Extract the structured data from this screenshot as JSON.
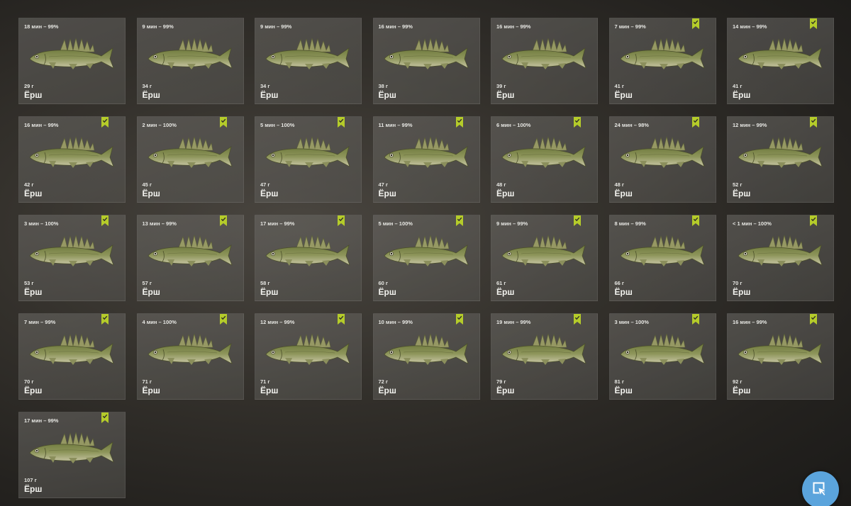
{
  "colors": {
    "accent_flag": "#b5cc2a",
    "button": "#5ba4dc"
  },
  "catches": [
    {
      "time": "18 мин – 99%",
      "weight": "29 г",
      "name": "Ёрш",
      "flag": false
    },
    {
      "time": "9 мин – 99%",
      "weight": "34 г",
      "name": "Ёрш",
      "flag": false
    },
    {
      "time": "9 мин – 99%",
      "weight": "34 г",
      "name": "Ёрш",
      "flag": false
    },
    {
      "time": "16 мин – 99%",
      "weight": "38 г",
      "name": "Ёрш",
      "flag": false
    },
    {
      "time": "16 мин – 99%",
      "weight": "39 г",
      "name": "Ёрш",
      "flag": false
    },
    {
      "time": "7 мин – 99%",
      "weight": "41 г",
      "name": "Ёрш",
      "flag": true
    },
    {
      "time": "14 мин – 99%",
      "weight": "41 г",
      "name": "Ёрш",
      "flag": true
    },
    {
      "time": "16 мин – 99%",
      "weight": "42 г",
      "name": "Ёрш",
      "flag": true
    },
    {
      "time": "2 мин – 100%",
      "weight": "45 г",
      "name": "Ёрш",
      "flag": true
    },
    {
      "time": "5 мин – 100%",
      "weight": "47 г",
      "name": "Ёрш",
      "flag": true
    },
    {
      "time": "11 мин – 99%",
      "weight": "47 г",
      "name": "Ёрш",
      "flag": true
    },
    {
      "time": "6 мин – 100%",
      "weight": "48 г",
      "name": "Ёрш",
      "flag": true
    },
    {
      "time": "24 мин – 98%",
      "weight": "48 г",
      "name": "Ёрш",
      "flag": true
    },
    {
      "time": "12 мин – 99%",
      "weight": "52 г",
      "name": "Ёрш",
      "flag": true
    },
    {
      "time": "3 мин – 100%",
      "weight": "53 г",
      "name": "Ёрш",
      "flag": true
    },
    {
      "time": "13 мин – 99%",
      "weight": "57 г",
      "name": "Ёрш",
      "flag": true
    },
    {
      "time": "17 мин – 99%",
      "weight": "58 г",
      "name": "Ёрш",
      "flag": true
    },
    {
      "time": "5 мин – 100%",
      "weight": "60 г",
      "name": "Ёрш",
      "flag": true
    },
    {
      "time": "9 мин – 99%",
      "weight": "61 г",
      "name": "Ёрш",
      "flag": true
    },
    {
      "time": "8 мин – 99%",
      "weight": "66 г",
      "name": "Ёрш",
      "flag": true
    },
    {
      "time": "< 1 мин – 100%",
      "weight": "70 г",
      "name": "Ёрш",
      "flag": true
    },
    {
      "time": "7 мин – 99%",
      "weight": "70 г",
      "name": "Ёрш",
      "flag": true
    },
    {
      "time": "4 мин – 100%",
      "weight": "71 г",
      "name": "Ёрш",
      "flag": true
    },
    {
      "time": "12 мин – 99%",
      "weight": "71 г",
      "name": "Ёрш",
      "flag": true
    },
    {
      "time": "10 мин – 99%",
      "weight": "72 г",
      "name": "Ёрш",
      "flag": true
    },
    {
      "time": "19 мин – 99%",
      "weight": "79 г",
      "name": "Ёрш",
      "flag": true
    },
    {
      "time": "3 мин – 100%",
      "weight": "81 г",
      "name": "Ёрш",
      "flag": true
    },
    {
      "time": "16 мин – 99%",
      "weight": "92 г",
      "name": "Ёрш",
      "flag": true
    },
    {
      "time": "17 мин – 99%",
      "weight": "107 г",
      "name": "Ёрш",
      "flag": true
    }
  ],
  "icons": {
    "flag": "bookmark-check-icon",
    "fish": "ruffe-fish-icon",
    "cursor": "cursor-select-icon"
  }
}
